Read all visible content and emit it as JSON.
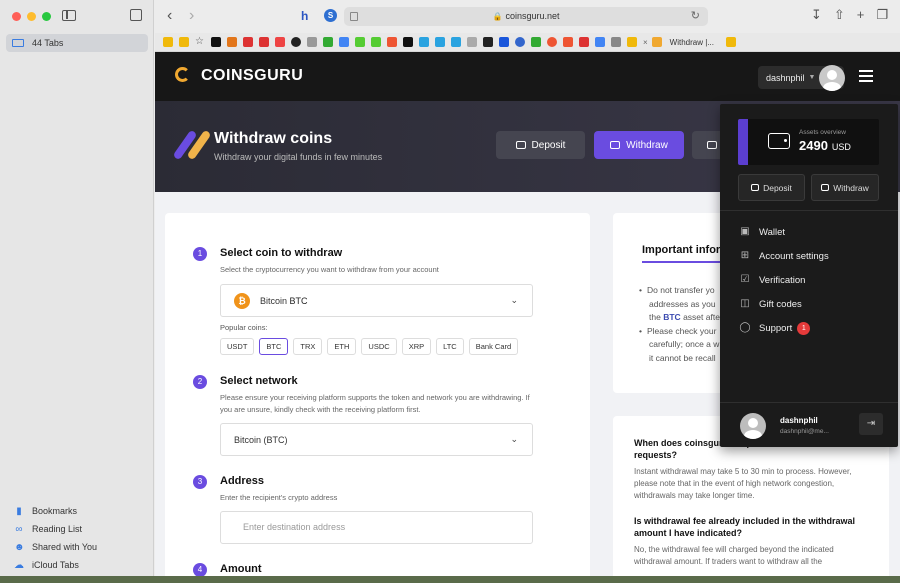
{
  "browser": {
    "sidebar_tabs_label": "44 Tabs",
    "url": "coinsguru.net",
    "sidebar_links": [
      {
        "label": "Bookmarks",
        "icon": "bookmark-icon"
      },
      {
        "label": "Reading List",
        "icon": "glasses-icon"
      },
      {
        "label": "Shared with You",
        "icon": "people-icon"
      },
      {
        "label": "iCloud Tabs",
        "icon": "cloud-icon"
      }
    ],
    "active_tab_label": "Withdraw |..."
  },
  "header": {
    "brand": "COINSGURU",
    "username": "dashnphil"
  },
  "banner": {
    "title": "Withdraw coins",
    "subtitle": "Withdraw your digital funds in few minutes",
    "deposit_label": "Deposit",
    "withdraw_label": "Withdraw"
  },
  "form": {
    "step1": {
      "num": "1",
      "title": "Select coin to withdraw",
      "desc": "Select the cryptocurrency you want to withdraw from your account"
    },
    "coin_select": {
      "name": "Bitcoin",
      "ticker": "BTC"
    },
    "popular_label": "Popular coins:",
    "popular_coins": [
      "USDT",
      "BTC",
      "TRX",
      "ETH",
      "USDC",
      "XRP",
      "LTC",
      "Bank Card"
    ],
    "step2": {
      "num": "2",
      "title": "Select network",
      "desc": "Please ensure your receiving platform supports the token and network you are withdrawing. If you are unsure, kindly check with the receiving platform first."
    },
    "network_select": "Bitcoin (BTC)",
    "step3": {
      "num": "3",
      "title": "Address",
      "desc": "Enter the recipient's crypto address"
    },
    "address_placeholder": "Enter destination address",
    "step4": {
      "num": "4",
      "title": "Amount"
    }
  },
  "info": {
    "title": "Important infor",
    "line1": "Do not transfer yo",
    "line2": "addresses as you",
    "line3_pre": "the",
    "line3_hl": "BTC",
    "line3_post": "asset afte",
    "line4": "Please check your",
    "line5": "carefully; once a w",
    "line6": "it cannot be recall"
  },
  "faq": [
    {
      "q": "When does coinsguru.net process withdrawal requests?",
      "a": "Instant withdrawal may take 5 to 30 min to process. However, please note that in the event of high network congestion, withdrawals may take longer time."
    },
    {
      "q": "Is withdrawal fee already included in the withdrawal amount I have indicated?",
      "a": "No, the withdrawal fee will charged beyond the indicated withdrawal amount. If traders want to withdraw all the"
    }
  ],
  "dropdown": {
    "assets_label": "Assets overview",
    "assets_value": "2490",
    "assets_currency": "USD",
    "deposit_label": "Deposit",
    "withdraw_label": "Withdraw",
    "menu": [
      {
        "label": "Wallet",
        "icon": "wallet-icon"
      },
      {
        "label": "Account settings",
        "icon": "grid-icon"
      },
      {
        "label": "Verification",
        "icon": "shield-icon"
      },
      {
        "label": "Gift codes",
        "icon": "gift-icon"
      },
      {
        "label": "Support",
        "icon": "chat-icon",
        "badge": "1"
      }
    ],
    "user_name": "dashnphil",
    "user_email": "dashnphil@me..."
  },
  "colors": {
    "accent": "#6a4ce0",
    "header_bg": "#171717",
    "brand_gold": "#f0a830"
  }
}
